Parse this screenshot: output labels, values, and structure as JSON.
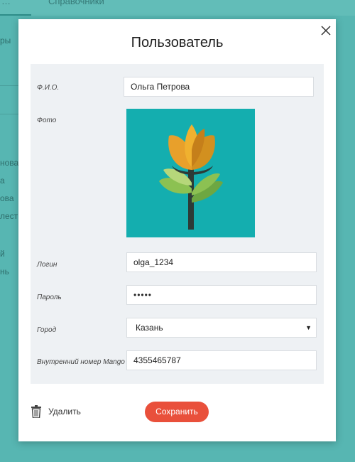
{
  "background": {
    "tabs": [
      "…",
      "Справочники"
    ],
    "list_label": "ры",
    "list_items": [
      "нова",
      "а",
      "ова",
      "лест",
      "й",
      "нь"
    ]
  },
  "modal": {
    "title": "Пользователь",
    "fields": {
      "fio": {
        "label": "Ф.И.О.",
        "value": "Ольга Петрова"
      },
      "photo": {
        "label": "Фото"
      },
      "login": {
        "label": "Логин",
        "value": "olga_1234"
      },
      "password": {
        "label": "Пароль",
        "value": "•••••"
      },
      "city": {
        "label": "Город",
        "value": "Казань"
      },
      "mango": {
        "label": "Внутренний номер Mango",
        "value": "4355465787"
      }
    },
    "delete_label": "Удалить",
    "save_label": "Сохранить"
  },
  "colors": {
    "overlay": "#4fb0ad",
    "panel": "#eef1f4",
    "photo_bg": "#14aeaf",
    "save_button": "#e9503b"
  },
  "icons": {
    "close": "close-icon",
    "trash": "trash-icon",
    "select_caret": "caret-down-icon"
  }
}
